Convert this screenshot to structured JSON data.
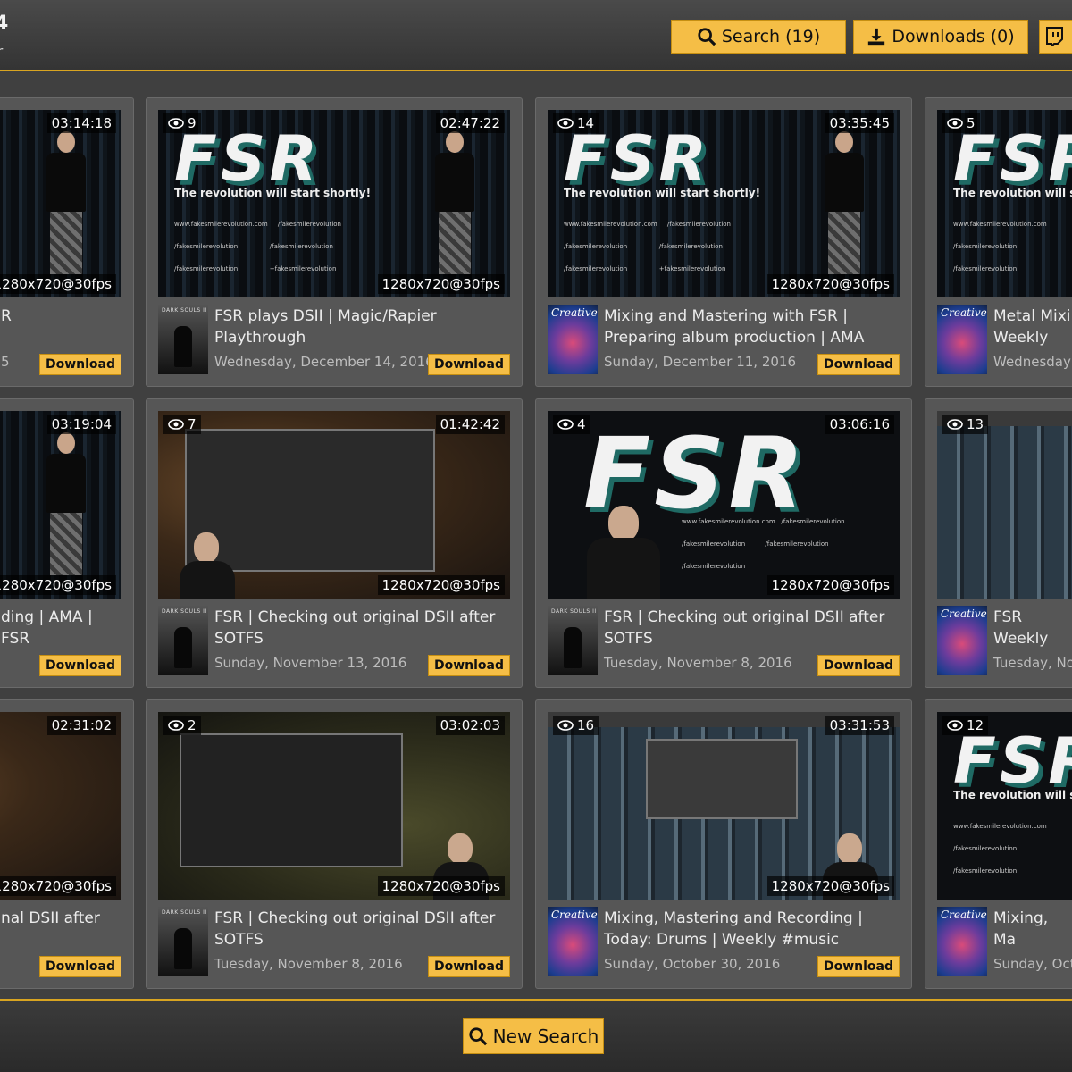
{
  "header": {
    "title": "4",
    "subtitle": "r",
    "search_label": "Search (19)",
    "downloads_label": "Downloads (0)"
  },
  "accent_color": "#f5be46",
  "thumb_text": {
    "tagline": "The revolution will start shortly!",
    "website": "www.fakesmilerevolution.com",
    "handle": "/fakesmilerevolution",
    "gplus": "+fakesmilerevolution",
    "logo": "FSR",
    "ds_logo": "DARK SOULS II",
    "creative_logo": "Creative"
  },
  "cards": [
    {
      "views": "",
      "duration": "03:14:18",
      "resolution": "1280x720@30fps",
      "title": "R",
      "date": "5",
      "download": "Download"
    },
    {
      "views": "9",
      "duration": "02:47:22",
      "resolution": "1280x720@30fps",
      "title": "FSR plays DSII | Magic/Rapier Playthrough",
      "date": "Wednesday, December 14, 2016",
      "download": "Download"
    },
    {
      "views": "14",
      "duration": "03:35:45",
      "resolution": "1280x720@30fps",
      "title": "Mixing and Mastering with FSR | Preparing album production | AMA #m...",
      "date": "Sunday, December 11, 2016",
      "download": "Download"
    },
    {
      "views": "5",
      "duration": "",
      "resolution": "",
      "title": "Metal Mixi Weekly #m",
      "date": "Wednesday,",
      "download": ""
    },
    {
      "views": "",
      "duration": "03:19:04",
      "resolution": "1280x720@30fps",
      "title": "ding | AMA | FSR",
      "date": "",
      "download": "Download"
    },
    {
      "views": "7",
      "duration": "01:42:42",
      "resolution": "1280x720@30fps",
      "title": "FSR | Checking out original DSII after SOTFS",
      "date": "Sunday, November 13, 2016",
      "download": "Download"
    },
    {
      "views": "4",
      "duration": "03:06:16",
      "resolution": "1280x720@30fps",
      "title": "FSR | Checking out original DSII after SOTFS",
      "date": "Tuesday, November 8, 2016",
      "download": "Download"
    },
    {
      "views": "13",
      "duration": "",
      "resolution": "",
      "title": "FSR Weekly Recording",
      "date": "Tuesday, No",
      "download": ""
    },
    {
      "views": "",
      "duration": "02:31:02",
      "resolution": "1280x720@30fps",
      "title": "nal DSII after",
      "date": "",
      "download": "Download"
    },
    {
      "views": "2",
      "duration": "03:02:03",
      "resolution": "1280x720@30fps",
      "title": "FSR | Checking out original DSII after SOTFS",
      "date": "Tuesday, November 8, 2016",
      "download": "Download"
    },
    {
      "views": "16",
      "duration": "03:31:53",
      "resolution": "1280x720@30fps",
      "title": "Mixing, Mastering and Recording | Today: Drums | Weekly #music #metal...",
      "date": "Sunday, October 30, 2016",
      "download": "Download"
    },
    {
      "views": "12",
      "duration": "",
      "resolution": "",
      "title": "Mixing, Ma Weekly #m",
      "date": "Sunday, Octo",
      "download": ""
    }
  ],
  "footer": {
    "new_search_label": "New Search"
  }
}
